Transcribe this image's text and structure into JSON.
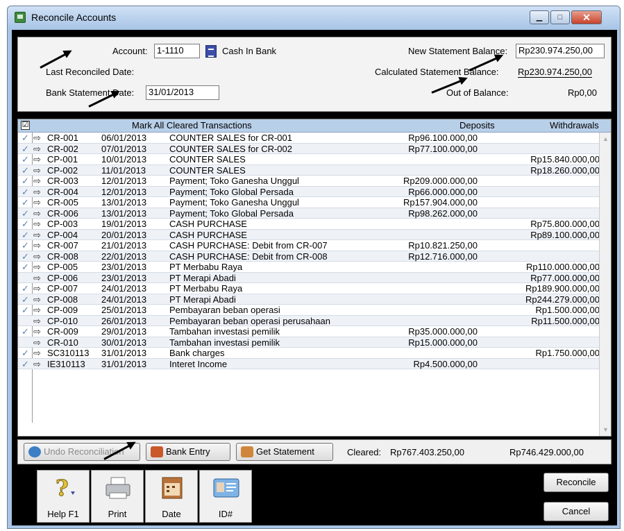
{
  "window": {
    "title": "Reconcile Accounts"
  },
  "header": {
    "account_label": "Account:",
    "account_value": "1-1110",
    "account_name": "Cash In Bank",
    "last_reconciled_label": "Last Reconciled Date:",
    "bank_statement_date_label": "Bank Statement Date:",
    "bank_statement_date_value": "31/01/2013",
    "new_statement_balance_label": "New Statement Balance:",
    "new_statement_balance_value": "Rp230.974.250,00",
    "calculated_statement_balance_label": "Calculated Statement Balance:",
    "calculated_statement_balance_value": "Rp230.974.250,00",
    "out_of_balance_label": "Out of Balance:",
    "out_of_balance_value": "Rp0,00"
  },
  "grid": {
    "header_check": "☑",
    "mark_all_label": "Mark All Cleared Transactions",
    "deposits_header": "Deposits",
    "withdrawals_header": "Withdrawals",
    "rows": [
      {
        "check": "✓",
        "id": "CR-001",
        "date": "06/01/2013",
        "memo": "COUNTER SALES for CR-001",
        "deposit": "Rp96.100.000,00",
        "withdrawal": ""
      },
      {
        "check": "✓",
        "id": "CR-002",
        "date": "07/01/2013",
        "memo": "COUNTER SALES for CR-002",
        "deposit": "Rp77.100.000,00",
        "withdrawal": ""
      },
      {
        "check": "✓",
        "id": "CP-001",
        "date": "10/01/2013",
        "memo": "COUNTER SALES",
        "deposit": "",
        "withdrawal": "Rp15.840.000,00"
      },
      {
        "check": "✓",
        "id": "CP-002",
        "date": "11/01/2013",
        "memo": "COUNTER SALES",
        "deposit": "",
        "withdrawal": "Rp18.260.000,00"
      },
      {
        "check": "✓",
        "id": "CR-003",
        "date": "12/01/2013",
        "memo": "Payment; Toko Ganesha Unggul",
        "deposit": "Rp209.000.000,00",
        "withdrawal": ""
      },
      {
        "check": "✓",
        "id": "CR-004",
        "date": "12/01/2013",
        "memo": "Payment; Toko Global Persada",
        "deposit": "Rp66.000.000,00",
        "withdrawal": ""
      },
      {
        "check": "✓",
        "id": "CR-005",
        "date": "13/01/2013",
        "memo": "Payment; Toko Ganesha Unggul",
        "deposit": "Rp157.904.000,00",
        "withdrawal": ""
      },
      {
        "check": "✓",
        "id": "CR-006",
        "date": "13/01/2013",
        "memo": "Payment; Toko Global Persada",
        "deposit": "Rp98.262.000,00",
        "withdrawal": ""
      },
      {
        "check": "✓",
        "id": "CP-003",
        "date": "19/01/2013",
        "memo": "CASH PURCHASE",
        "deposit": "",
        "withdrawal": "Rp75.800.000,00"
      },
      {
        "check": "✓",
        "id": "CP-004",
        "date": "20/01/2013",
        "memo": "CASH PURCHASE",
        "deposit": "",
        "withdrawal": "Rp89.100.000,00"
      },
      {
        "check": "✓",
        "id": "CR-007",
        "date": "21/01/2013",
        "memo": "CASH PURCHASE:  Debit from CR-007",
        "deposit": "Rp10.821.250,00",
        "withdrawal": ""
      },
      {
        "check": "✓",
        "id": "CR-008",
        "date": "22/01/2013",
        "memo": "CASH PURCHASE:  Debit from CR-008",
        "deposit": "Rp12.716.000,00",
        "withdrawal": ""
      },
      {
        "check": "✓",
        "id": "CP-005",
        "date": "23/01/2013",
        "memo": "PT Merbabu Raya",
        "deposit": "",
        "withdrawal": "Rp110.000.000,00"
      },
      {
        "check": "",
        "id": "CP-006",
        "date": "23/01/2013",
        "memo": "PT Merapi Abadi",
        "deposit": "",
        "withdrawal": "Rp77.000.000,00"
      },
      {
        "check": "✓",
        "id": "CP-007",
        "date": "24/01/2013",
        "memo": "PT Merbabu Raya",
        "deposit": "",
        "withdrawal": "Rp189.900.000,00"
      },
      {
        "check": "✓",
        "id": "CP-008",
        "date": "24/01/2013",
        "memo": "PT Merapi Abadi",
        "deposit": "",
        "withdrawal": "Rp244.279.000,00"
      },
      {
        "check": "✓",
        "id": "CP-009",
        "date": "25/01/2013",
        "memo": "Pembayaran beban operasi",
        "deposit": "",
        "withdrawal": "Rp1.500.000,00"
      },
      {
        "check": "",
        "id": "CP-010",
        "date": "26/01/2013",
        "memo": "Pembayaran beban operasi perusahaan",
        "deposit": "",
        "withdrawal": "Rp11.500.000,00"
      },
      {
        "check": "✓",
        "id": "CR-009",
        "date": "29/01/2013",
        "memo": "Tambahan investasi pemilik",
        "deposit": "Rp35.000.000,00",
        "withdrawal": ""
      },
      {
        "check": "",
        "id": "CR-010",
        "date": "30/01/2013",
        "memo": "Tambahan investasi pemilik",
        "deposit": "Rp15.000.000,00",
        "withdrawal": ""
      },
      {
        "check": "✓",
        "id": "SC310113",
        "date": "31/01/2013",
        "memo": "Bank charges",
        "deposit": "",
        "withdrawal": "Rp1.750.000,00"
      },
      {
        "check": "✓",
        "id": "IE310113",
        "date": "31/01/2013",
        "memo": "Interet Income",
        "deposit": "Rp4.500.000,00",
        "withdrawal": ""
      }
    ]
  },
  "actions": {
    "undo_label": "Undo Reconciliation",
    "bank_entry_label": "Bank Entry",
    "get_statement_label": "Get Statement",
    "cleared_label": "Cleared:",
    "cleared_deposits": "Rp767.403.250,00",
    "cleared_withdrawals": "Rp746.429.000,00"
  },
  "toolbar": {
    "help_label": "Help F1",
    "print_label": "Print",
    "date_label": "Date",
    "id_label": "ID#"
  },
  "buttons": {
    "reconcile": "Reconcile",
    "cancel": "Cancel"
  },
  "colors": {
    "title_bar": "#a7c4e6",
    "grid_header": "#b8cfe8",
    "close_button": "#c8412b"
  }
}
